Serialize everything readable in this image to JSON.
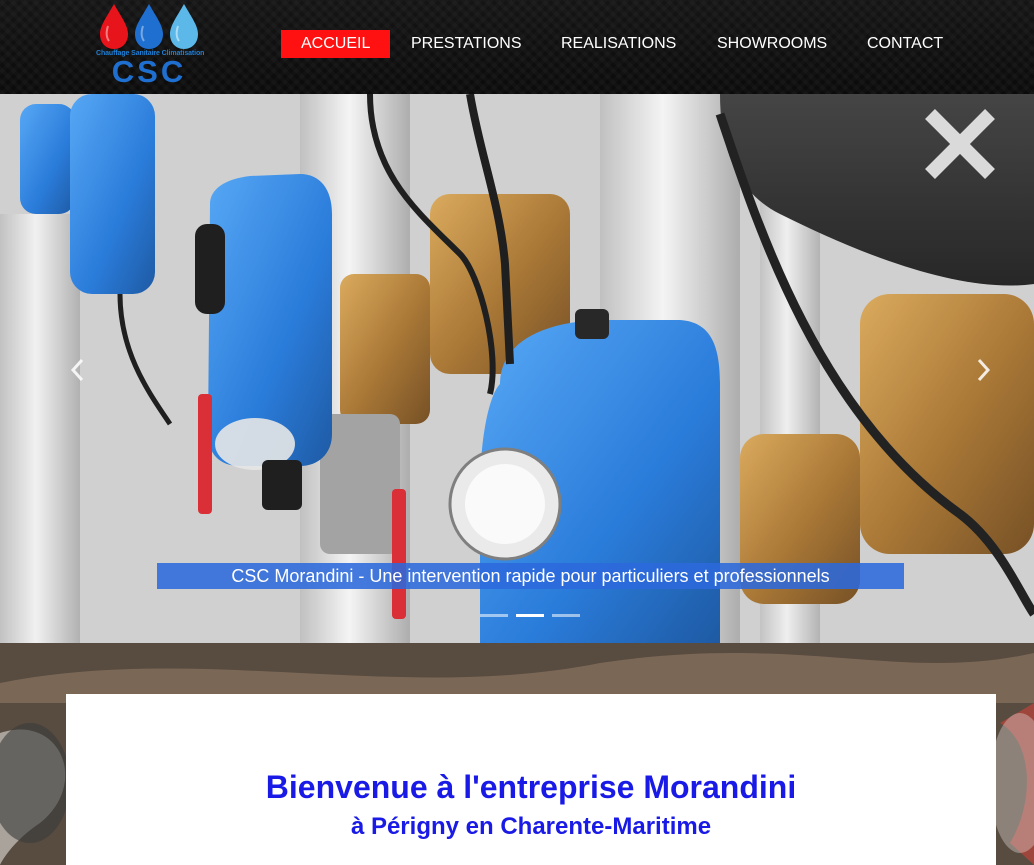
{
  "brand": {
    "logo_tagline": "Chauffage Sanitaire Climatisation",
    "logo_text": "CSC",
    "drop_colors": [
      "#e8141b",
      "#1f6fd0",
      "#5bb8e8"
    ]
  },
  "nav": {
    "items": [
      {
        "label": "ACCUEIL",
        "active": true
      },
      {
        "label": "PRESTATIONS",
        "active": false
      },
      {
        "label": "REALISATIONS",
        "active": false
      },
      {
        "label": "SHOWROOMS",
        "active": false
      },
      {
        "label": "CONTACT",
        "active": false
      }
    ],
    "active_color": "#ff1111"
  },
  "carousel": {
    "caption": "CSC Morandini - Une intervention rapide pour particuliers et professionnels",
    "indicator_count": 3,
    "active_indicator": 2,
    "prev_icon": "chevron-left-icon",
    "next_icon": "chevron-right-icon"
  },
  "welcome": {
    "title": "Bienvenue à l'entreprise Morandini",
    "subtitle": "à Périgny en Charente-Maritime"
  },
  "colors": {
    "accent_red": "#ff1111",
    "caption_blue": "#2c69dc",
    "heading_blue": "#1a1ae6"
  }
}
